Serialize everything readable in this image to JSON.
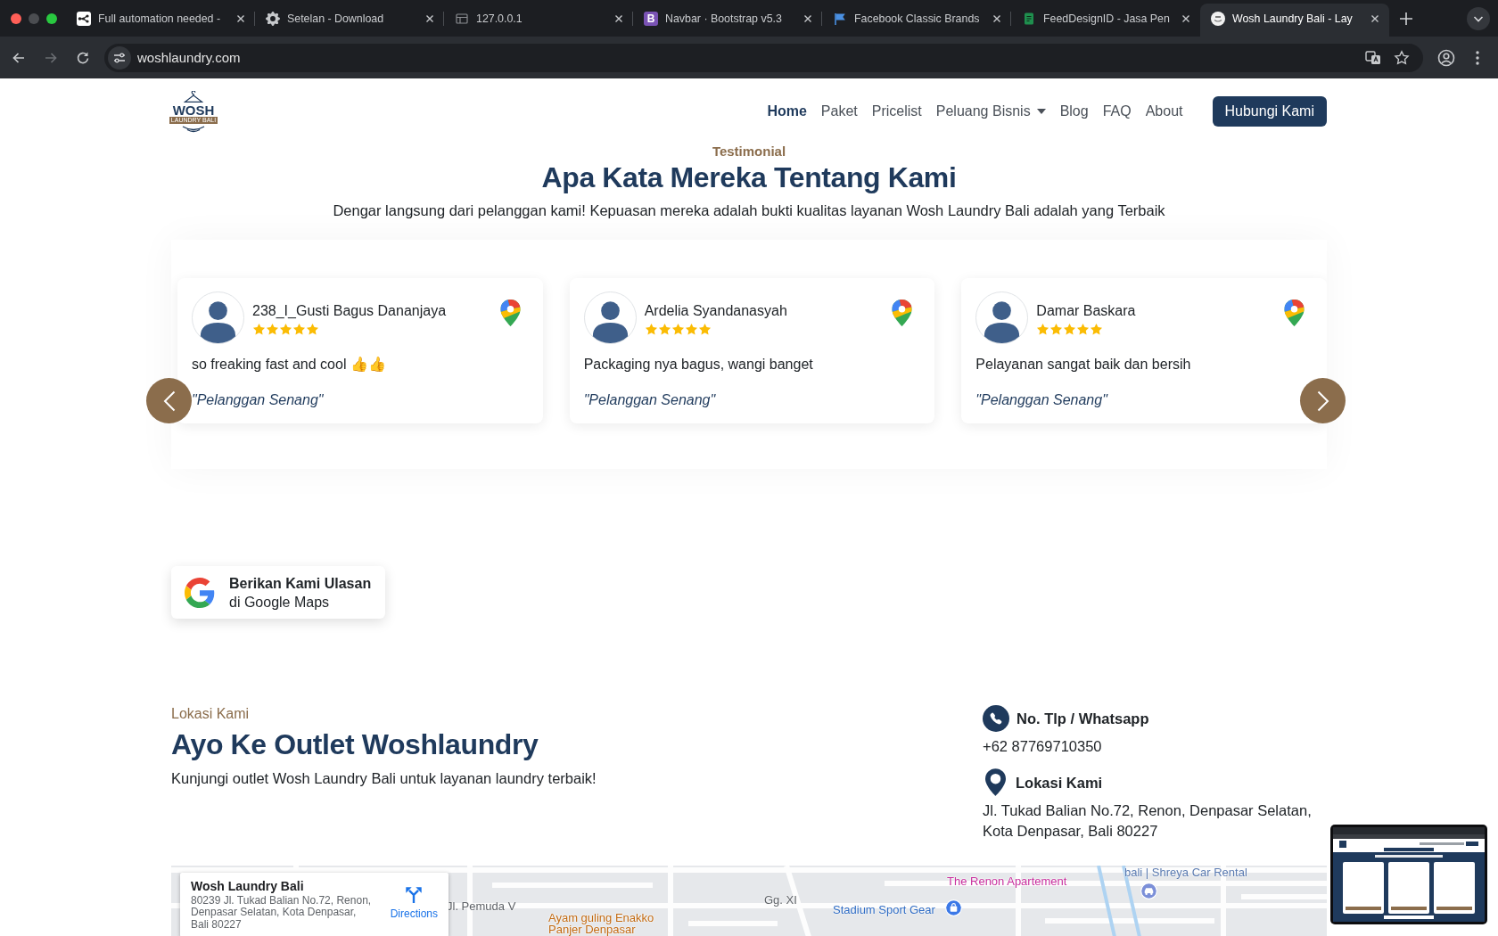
{
  "browser": {
    "tabs": [
      {
        "title": "Full automation needed -",
        "selected": false
      },
      {
        "title": "Setelan - Download",
        "selected": false
      },
      {
        "title": "127.0.0.1",
        "selected": false
      },
      {
        "title": "Navbar · Bootstrap v5.3",
        "icon_text": "B",
        "selected": false
      },
      {
        "title": "Facebook Classic Brands",
        "selected": false
      },
      {
        "title": "FeedDesignID - Jasa Pen",
        "selected": false
      },
      {
        "title": "Wosh Laundry Bali - Lay",
        "selected": true
      }
    ],
    "nav_buttons": [
      {
        "kind": "back",
        "disabled": false
      },
      {
        "kind": "forward",
        "disabled": true
      },
      {
        "kind": "reload",
        "disabled": false
      }
    ],
    "url": "woshlaundry.com"
  },
  "navbar": {
    "logo": {
      "name": "WOSH",
      "tagline": "LAUNDRY BALI"
    },
    "links": [
      {
        "label": "Home",
        "kind": "link",
        "selected": true
      },
      {
        "label": "Paket",
        "kind": "link",
        "selected": false
      },
      {
        "label": "Pricelist",
        "kind": "link",
        "selected": false
      },
      {
        "label": "Peluang Bisnis",
        "kind": "dropdown",
        "selected": false
      },
      {
        "label": "Blog",
        "kind": "link",
        "selected": false
      },
      {
        "label": "FAQ",
        "kind": "link",
        "selected": false
      },
      {
        "label": "About",
        "kind": "link",
        "selected": false
      }
    ],
    "cta": "Hubungi Kami"
  },
  "testimonials": {
    "eyebrow": "Testimonial",
    "title": "Apa Kata Mereka Tentang Kami",
    "subtitle": "Dengar langsung dari pelanggan kami! Kepuasan mereka adalah bukti kualitas layanan Wosh Laundry Bali adalah yang Terbaik",
    "reviews": [
      {
        "name": "238_I_Gusti Bagus Dananjaya",
        "stars": 5,
        "text": "so freaking fast and cool 👍👍",
        "tag": "\"Pelanggan Senang\""
      },
      {
        "name": "Ardelia Syandanasyah",
        "stars": 5,
        "text": "Packaging nya bagus, wangi banget",
        "tag": "\"Pelanggan Senang\""
      },
      {
        "name": "Damar Baskara",
        "stars": 5,
        "text": "Pelayanan sangat baik dan bersih",
        "tag": "\"Pelanggan Senang\""
      }
    ],
    "review_button": {
      "title": "Berikan Kami Ulasan",
      "subtitle": "di Google Maps"
    }
  },
  "location": {
    "eyebrow": "Lokasi Kami",
    "title": "Ayo Ke Outlet Woshlaundry",
    "text": "Kunjungi outlet Wosh Laundry Bali untuk layanan laundry terbaik!",
    "contacts": [
      {
        "kind": "phone",
        "label": "No. Tlp / Whatsapp",
        "value": "+62 87769710350"
      },
      {
        "kind": "pin",
        "label": "Lokasi Kami",
        "value": "Jl. Tukad Balian No.72, Renon, Denpasar Selatan, Kota Denpasar, Bali 80227"
      }
    ]
  },
  "map": {
    "place": {
      "name": "Wosh Laundry Bali",
      "address": "80239 Jl. Tukad Balian No.72, Renon, Denpasar Selatan, Kota Denpasar, Bali 80227",
      "action": "Directions"
    },
    "labels": [
      {
        "text": "bali | Shreya Car Rental",
        "kind": "business"
      },
      {
        "text": "The Renon Apartement",
        "kind": "lodging"
      },
      {
        "text": "Gg. XI",
        "kind": "street"
      },
      {
        "text": "Jl. Pemuda V",
        "kind": "street"
      },
      {
        "text": "Stadium Sport Gear",
        "kind": "shopping"
      },
      {
        "text": "Ayam guling Enakko Panjer Denpasar",
        "kind": "food"
      }
    ]
  }
}
